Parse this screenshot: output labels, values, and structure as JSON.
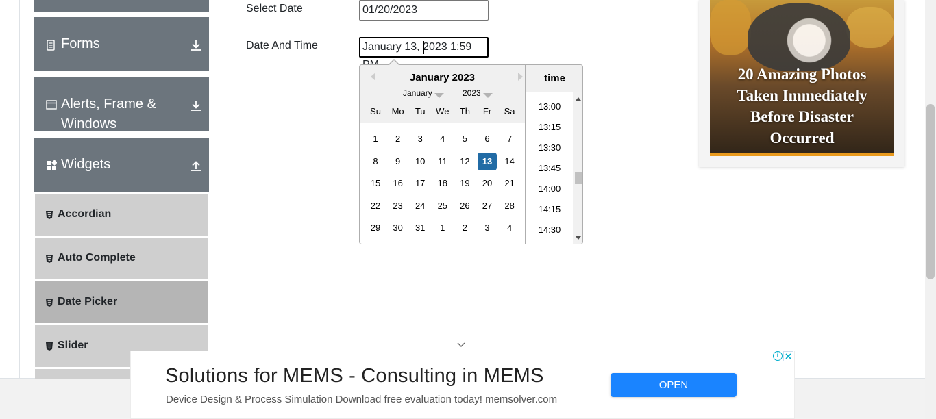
{
  "sidebar": {
    "groups": [
      {
        "label": "Forms",
        "icon": "document-icon",
        "state": "collapsed"
      },
      {
        "label": "Alerts, Frame &",
        "label2": "Windows",
        "icon": "window-icon",
        "state": "collapsed"
      },
      {
        "label": "Widgets",
        "icon": "widgets-icon",
        "state": "expanded"
      }
    ],
    "items": [
      {
        "label": "Accordian",
        "active": false
      },
      {
        "label": "Auto Complete",
        "active": false
      },
      {
        "label": "Date Picker",
        "active": true
      },
      {
        "label": "Slider",
        "active": false
      }
    ]
  },
  "form": {
    "select_date": {
      "label": "Select Date",
      "value": "01/20/2023"
    },
    "date_time": {
      "label": "Date And Time",
      "value": "January 13, 2023 1:59 PM"
    }
  },
  "datepicker": {
    "header": "January 2023",
    "month_select": "January",
    "year_select": "2023",
    "weekdays": [
      "Su",
      "Mo",
      "Tu",
      "We",
      "Th",
      "Fr",
      "Sa"
    ],
    "weeks": [
      [
        "1",
        "2",
        "3",
        "4",
        "5",
        "6",
        "7"
      ],
      [
        "8",
        "9",
        "10",
        "11",
        "12",
        "13",
        "14"
      ],
      [
        "15",
        "16",
        "17",
        "18",
        "19",
        "20",
        "21"
      ],
      [
        "22",
        "23",
        "24",
        "25",
        "26",
        "27",
        "28"
      ],
      [
        "29",
        "30",
        "31",
        "1",
        "2",
        "3",
        "4"
      ]
    ],
    "selected_day": "13",
    "time_header": "time",
    "times": [
      "13:00",
      "13:15",
      "13:30",
      "13:45",
      "14:00",
      "14:15",
      "14:30"
    ]
  },
  "ad_card": {
    "headline": [
      "20 Amazing Photos",
      "Taken Immediately",
      "Before Disaster",
      "Occurred"
    ]
  },
  "banner": {
    "headline": "Solutions for MEMS - Consulting in MEMS",
    "sub": "Device Design & Process Simulation Download free evaluation today! memsolver.com",
    "button": "OPEN"
  },
  "colors": {
    "sidebar_group_bg": "#6c757d",
    "sidebar_item_bg": "#cfcfcf",
    "sidebar_item_active_bg": "#b5b5b5",
    "selected_day_bg": "#216ba5",
    "banner_button_bg": "#1a84ff"
  }
}
